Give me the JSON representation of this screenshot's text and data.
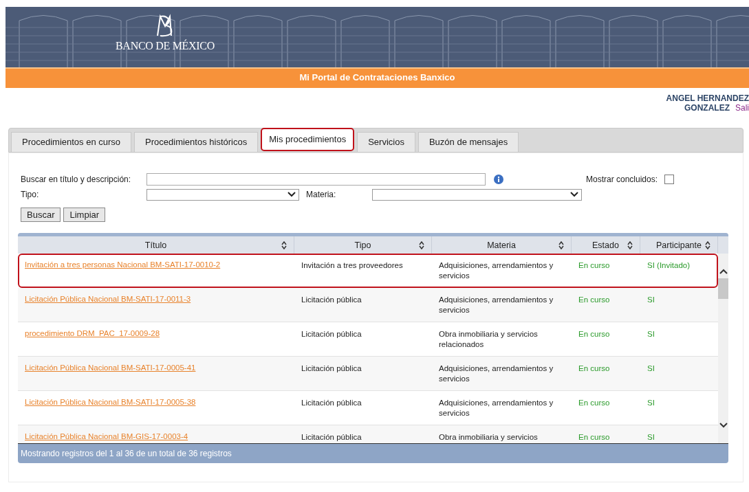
{
  "header": {
    "logo_text": "BANCO DE MÉXICO",
    "portal_title": "Mi Portal de Contrataciones Banxico"
  },
  "user": {
    "name_line1": "ANGEL HERNANDEZ",
    "name_line2": "GONZALEZ",
    "logout": "Sali"
  },
  "tabs": [
    {
      "label": "Procedimientos en curso",
      "selected": false
    },
    {
      "label": "Procedimientos históricos",
      "selected": false
    },
    {
      "label": "Mis procedimientos",
      "selected": true
    },
    {
      "label": "Servicios",
      "selected": false
    },
    {
      "label": "Buzón de mensajes",
      "selected": false
    }
  ],
  "search": {
    "search_label": "Buscar en título y descripción:",
    "tipo_label": "Tipo:",
    "materia_label": "Materia:",
    "concluded_label": "Mostrar concluidos:",
    "show_concluded": false,
    "buttons": [
      "Buscar",
      "Limpiar"
    ]
  },
  "table": {
    "columns": [
      "Título",
      "Tipo",
      "Materia",
      "Estado",
      "Participante"
    ],
    "rows": [
      {
        "titulo": "Invitación a tres personas Nacional BM-SATI-17-0010-2",
        "tipo": "Invitación a tres proveedores",
        "materia": "Adquisiciones, arrendamientos y servicios",
        "estado": "En curso",
        "participante": "SI (Invitado)",
        "highlighted": true
      },
      {
        "titulo": "Licitación Pública Nacional BM-SATI-17-0011-3",
        "tipo": "Licitación pública",
        "materia": "Adquisiciones, arrendamientos y servicios",
        "estado": "En curso",
        "participante": "SI",
        "highlighted": false
      },
      {
        "titulo": "procedimiento DRM_PAC_17-0009-28",
        "tipo": "Licitación pública",
        "materia": "Obra inmobiliaria y servicios relacionados",
        "estado": "En curso",
        "participante": "SI",
        "highlighted": false
      },
      {
        "titulo": "Licitación Pública Nacional BM-SATI-17-0005-41",
        "tipo": "Licitación pública",
        "materia": "Adquisiciones, arrendamientos y servicios",
        "estado": "En curso",
        "participante": "SI",
        "highlighted": false
      },
      {
        "titulo": "Licitación Pública Nacional BM-SATI-17-0005-38",
        "tipo": "Licitación pública",
        "materia": "Adquisiciones, arrendamientos y servicios",
        "estado": "En curso",
        "participante": "SI",
        "highlighted": false
      },
      {
        "titulo": "Licitación Pública Nacional BM-GIS-17-0003-4",
        "tipo": "Licitación pública",
        "materia": "Obra inmobiliaria y servicios",
        "estado": "En curso",
        "participante": "SI",
        "highlighted": false
      }
    ],
    "footer": "Mostrando registros del 1 al 36 de un total de 36 registros"
  }
}
